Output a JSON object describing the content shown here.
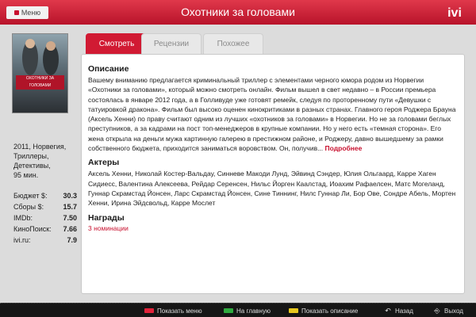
{
  "header": {
    "menu_label": "Меню",
    "title": "Охотники за головами",
    "logo_text": "ivi"
  },
  "poster": {
    "title_text": "ОХОТНИКИ ЗА ГОЛОВАМИ",
    "tagline": "ДЕВУШКА С ТАТУИРОВКОЙ"
  },
  "movie_meta": {
    "line1": "2011, Норвегия,",
    "line2": "Триллеры,",
    "line3": "Детективы,",
    "line4": "95 мин."
  },
  "stats": [
    {
      "label": "Бюджет $:",
      "value": "30.3"
    },
    {
      "label": "Сборы $:",
      "value": "15.7"
    },
    {
      "label": "IMDb:",
      "value": "7.50"
    },
    {
      "label": "КиноПоиск:",
      "value": "7.66"
    },
    {
      "label": "ivi.ru:",
      "value": "7.9"
    }
  ],
  "tabs": [
    {
      "label": "Смотреть",
      "active": true
    },
    {
      "label": "Рецензии",
      "active": false
    },
    {
      "label": "Похожее",
      "active": false
    }
  ],
  "description": {
    "heading": "Описание",
    "text": "Вашему вниманию предлагается криминальный триллер с элементами черного юмора родом из Норвегии «Охотники за головами», который можно смотреть онлайн. Фильм вышел в свет недавно – в России премьера состоялась в январе 2012 года, а в Голливуде уже готовят ремейк, следуя по проторенному пути «Девушки с татуировкой дракона». Фильм был высоко оценен кинокритиками в разных странах. Главного героя Роджера Брауна (Аксель Хенни) по праву считают одним из лучших «охотников за головами» в Норвегии. Но не за головами беглых преступников, а за кадрами на пост топ-менеджеров в крупные компании. Но у него есть «темная сторона». Его жена открыла на деньги мужа картинную галерею в престижном районе, и Роджеру, давно вышедшему за рамки собственного бюджета, приходится заниматься воровством. Он, получив...",
    "more_label": "Подробнее"
  },
  "actors": {
    "heading": "Актеры",
    "text": "Аксель Хенни, Николай Костер-Вальдау, Синневе Макоди Лунд, Эйвинд Сэндер, Юлия Ольгаард, Карре Хаген Сидиесс, Валентина Алексеева, Рейдар Серенсен, Нильс Йорген Каалстад, Иоахим Рафаелсен, Матс Могеланд, Гуннар Скрамстад Йонсен, Ларс Скрамстад Йонсен, Сине Тиннинг, Нилс Гуннар Ли, Бор Ове, Сондре Абель, Мортен Хенни, Ирина Эйдсвольд, Карре Мослет"
  },
  "awards": {
    "heading": "Награды",
    "link": "3 номинации"
  },
  "footer": {
    "show_menu": "Показать меню",
    "to_start": "На главную",
    "show_desc": "Показать описание",
    "back": "Назад",
    "exit": "Выход"
  },
  "colors": {
    "accent": "#c8102e",
    "red_key": "#e2233b",
    "green_key": "#2faa3f",
    "yellow_key": "#e8c81e",
    "blue_key": "#2a62c8"
  }
}
